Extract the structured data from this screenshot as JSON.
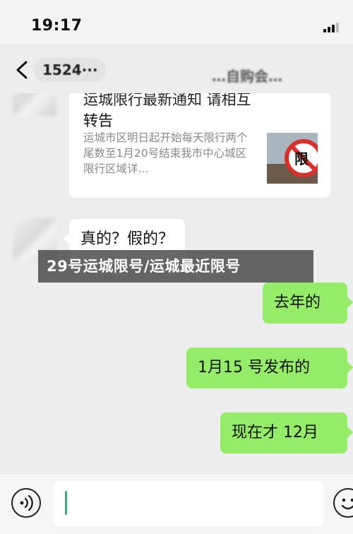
{
  "status_bar": {
    "time": "19:17"
  },
  "nav": {
    "title": "1524···",
    "title_right": "…自购会…"
  },
  "article": {
    "title_line1": "运城限行最新通知 请相互",
    "title_line2": "转告",
    "description": "运城市区明日起开始每天限行两个尾数至1月20号结束我市中心城区限行区域详...",
    "thumb_text": "限"
  },
  "messages": [
    {
      "direction": "in",
      "text": "真的？假的？"
    },
    {
      "direction": "out",
      "text": "去年的"
    },
    {
      "direction": "out",
      "text": "1月15 号发布的"
    },
    {
      "direction": "out",
      "text": "现在才 12月"
    }
  ],
  "overlay": {
    "text": "29号运城限号/运城最近限号"
  },
  "input_bar": {
    "value": ""
  },
  "colors": {
    "outgoing_bubble": "#95ec69",
    "incoming_bubble": "#ffffff",
    "chat_background": "#ededed",
    "no_entry_sign": "#d9302c"
  },
  "icons": [
    "back-chevron-icon",
    "signal-icon",
    "voice-icon",
    "emoji-icon",
    "no-entry-sign-icon"
  ]
}
